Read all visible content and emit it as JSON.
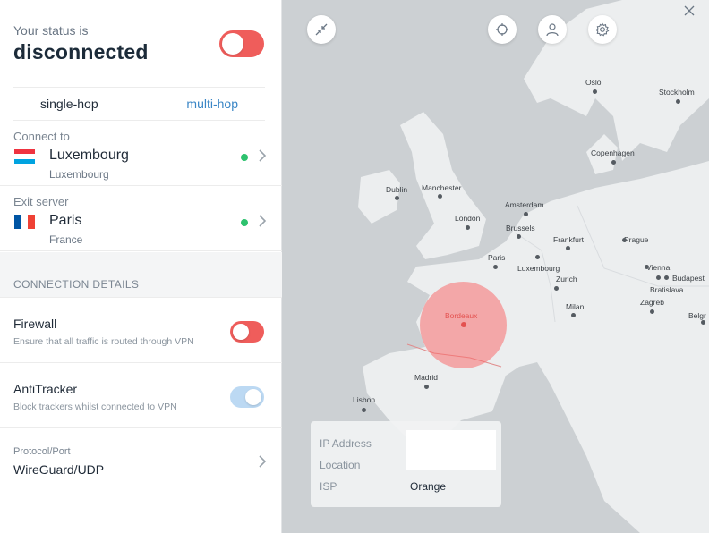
{
  "status": {
    "label": "Your status is",
    "value": "disconnected",
    "toggle_color": "#ef5d5b"
  },
  "hop": {
    "single": "single-hop",
    "multi": "multi-hop"
  },
  "connect_to": {
    "caption": "Connect to",
    "name": "Luxembourg",
    "sub": "Luxembourg",
    "flag": "luxembourg-flag"
  },
  "exit_server": {
    "caption": "Exit server",
    "name": "Paris",
    "sub": "France",
    "flag": "france-flag"
  },
  "details": {
    "header": "CONNECTION DETAILS",
    "firewall": {
      "title": "Firewall",
      "desc": "Ensure that all traffic is routed through VPN",
      "state": "on"
    },
    "antitracker": {
      "title": "AntiTracker",
      "desc": "Block trackers whilst connected to VPN",
      "state": "on"
    },
    "protocol": {
      "caption": "Protocol/Port",
      "value": "WireGuard/UDP"
    }
  },
  "map": {
    "highlight_city": "Bordeaux",
    "cities": {
      "oslo": "Oslo",
      "stockholm": "Stockholm",
      "copenhagen": "Copenhagen",
      "dublin": "Dublin",
      "manchester": "Manchester",
      "amsterdam": "Amsterdam",
      "london": "London",
      "brussels": "Brussels",
      "frankfurt": "Frankfurt",
      "prague": "Prague",
      "paris": "Paris",
      "luxembourg": "Luxembourg",
      "vienna": "Vienna",
      "budapest": "Budapest",
      "bratislava": "Bratislava",
      "zurich": "Zurich",
      "zagreb": "Zagreb",
      "milan": "Milan",
      "belgrade": "Belgr",
      "madrid": "Madrid",
      "lisbon": "Lisbon"
    },
    "icons": {
      "collapse": "collapse-arrows-icon",
      "locate": "crosshair-icon",
      "account": "user-icon",
      "settings": "gear-icon",
      "close": "close-icon"
    }
  },
  "info": {
    "ip_label": "IP Address",
    "location_label": "Location",
    "isp_label": "ISP",
    "isp_value": "Orange"
  },
  "colors": {
    "accent_link": "#3a86c6",
    "status_red": "#ef5d5b",
    "online_green": "#2dc26e",
    "toggle_blue": "#bcd9f3"
  }
}
